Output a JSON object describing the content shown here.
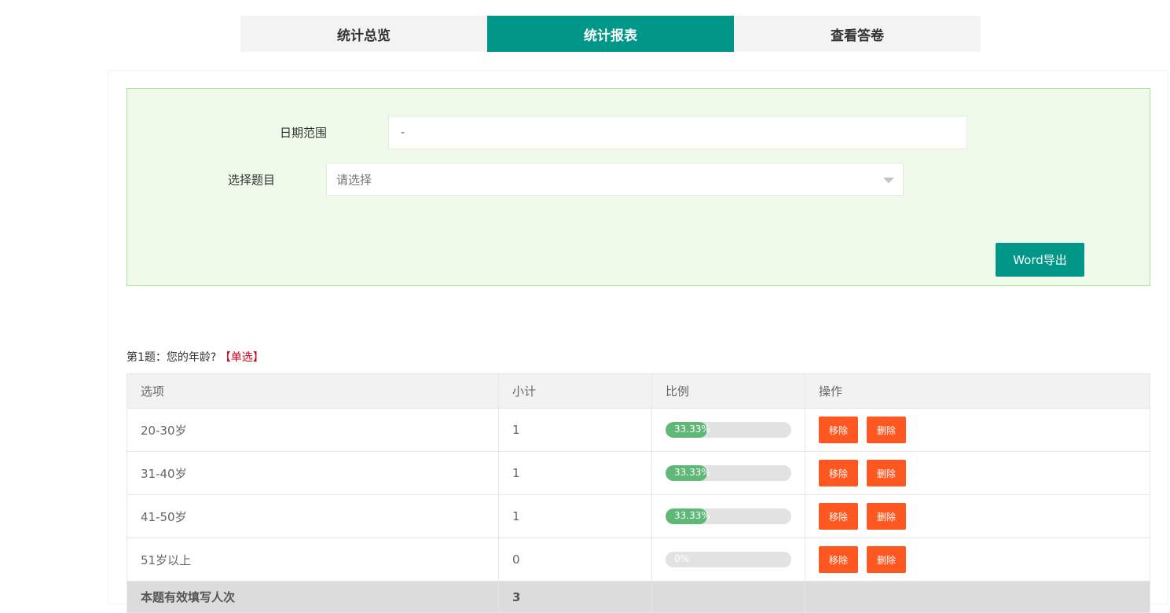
{
  "tabs": [
    {
      "label": "统计总览",
      "active": false
    },
    {
      "label": "统计报表",
      "active": true
    },
    {
      "label": "查看答卷",
      "active": false
    }
  ],
  "filters": {
    "date_label": "日期范围",
    "date_value": "-",
    "question_label": "选择题目",
    "question_placeholder": "请选择",
    "export_label": "Word导出"
  },
  "question": {
    "title": "第1题：您的年龄?",
    "type": "【单选】",
    "columns": [
      "选项",
      "小计",
      "比例",
      "操作"
    ],
    "rows": [
      {
        "option": "20-30岁",
        "count": "1",
        "percent_label": "33.33%",
        "percent": 33.33
      },
      {
        "option": "31-40岁",
        "count": "1",
        "percent_label": "33.33%",
        "percent": 33.33
      },
      {
        "option": "41-50岁",
        "count": "1",
        "percent_label": "33.33%",
        "percent": 33.33
      },
      {
        "option": "51岁以上",
        "count": "0",
        "percent_label": "0%",
        "percent": 0
      }
    ],
    "action_remove": "移除",
    "action_delete": "删除",
    "summary_label": "本题有效填写人次",
    "summary_count": "3"
  },
  "colors": {
    "primary": "#009688",
    "danger": "#ff5722",
    "progress": "#5fb878"
  }
}
